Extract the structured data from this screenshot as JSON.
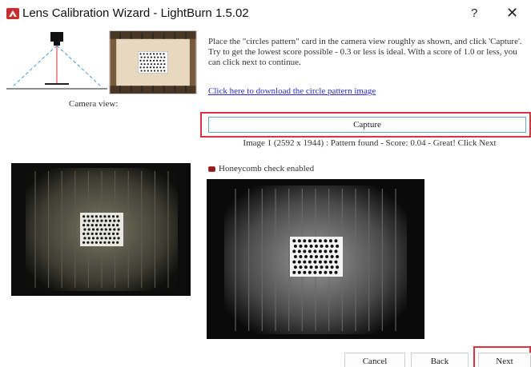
{
  "window": {
    "title": "Lens Calibration Wizard - LightBurn 1.5.02",
    "help_label": "?",
    "close_label": "✕"
  },
  "instructions": "Place the \"circles pattern\" card in the camera view roughly as shown, and click 'Capture'. Try to get the lowest score possible - 0.3 or less is ideal.  With a score of 1.0 or less, you can click next to continue.",
  "download_link": "Click here to download the circle pattern image",
  "camera_view_label": "Camera view:",
  "capture_button": "Capture",
  "status": "Image 1 (2592 x 1944) : Pattern found - Score: 0.04 - Great! Click Next",
  "honeycomb": {
    "label": "Honeycomb check enabled",
    "checked": true
  },
  "buttons": {
    "cancel": "Cancel",
    "back": "Back",
    "next": "Next"
  },
  "colors": {
    "highlight": "#d9343f",
    "link": "#2a2ad8",
    "capture_border": "#6ba6d6"
  }
}
